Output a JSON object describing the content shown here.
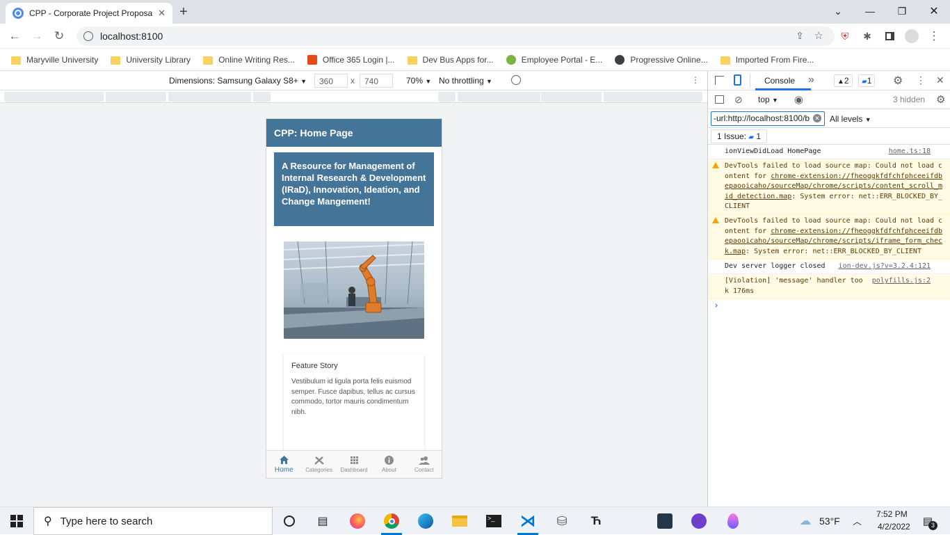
{
  "browser": {
    "tab_title": "CPP - Corporate Project Proposal",
    "url": "localhost:8100",
    "bookmarks": [
      {
        "label": "Maryville University",
        "icon": "folder-icon"
      },
      {
        "label": "University Library",
        "icon": "folder-icon"
      },
      {
        "label": "Online Writing Res...",
        "icon": "folder-icon"
      },
      {
        "label": "Office 365 Login |...",
        "icon": "office-icon"
      },
      {
        "label": "Dev Bus Apps for...",
        "icon": "folder-icon"
      },
      {
        "label": "Employee Portal - E...",
        "icon": "portal-icon"
      },
      {
        "label": "Progressive Online...",
        "icon": "globe-icon"
      },
      {
        "label": "Imported From Fire...",
        "icon": "folder-icon"
      }
    ]
  },
  "device_toolbar": {
    "dimensions_label": "Dimensions: Samsung Galaxy S8+",
    "width": "360",
    "height": "740",
    "times": "x",
    "zoom": "70%",
    "throttling": "No throttling"
  },
  "app": {
    "toolbar_title": "CPP: Home Page",
    "banner_text": "A Resource for Management of Internal Research & Development (IRaD), Innovation, Ideation, and Change Mangement!",
    "card_title": "Feature Story",
    "card_body": "Vestibulum id ligula porta felis euismod semper. Fusce dapibus, tellus ac cursus commodo, tortor mauris condimentum nibh.",
    "tabs": [
      {
        "label": "Home",
        "icon": "home-icon",
        "active": true
      },
      {
        "label": "Categories",
        "icon": "tools-icon",
        "active": false
      },
      {
        "label": "Dashboard",
        "icon": "grid-icon",
        "active": false
      },
      {
        "label": "About",
        "icon": "info-icon",
        "active": false
      },
      {
        "label": "Contact",
        "icon": "people-icon",
        "active": false
      }
    ],
    "accent_color": "#457499"
  },
  "devtools": {
    "panel_tab": "Console",
    "more_tabs": "»",
    "warnings_count": "2",
    "messages_count": "1",
    "context": "top",
    "hidden_count": "3 hidden",
    "filter_value": "-url:http://localhost:8100/b",
    "levels": "All levels",
    "issues_label": "1 Issue:",
    "issues_count": "1",
    "messages": [
      {
        "type": "log",
        "text": "ionViewDidLoad HomePage",
        "source": "home.ts:18"
      },
      {
        "type": "warn",
        "pre": "DevTools failed to load source map: Could not load content for ",
        "link": "chrome-extension://fheoggkfdfchfphceeifdbepaooicaho/sourceMap/chrome/scripts/content_scroll_mid_detection.map",
        "post": ": System error: net::ERR_BLOCKED_BY_CLIENT"
      },
      {
        "type": "warn",
        "pre": "DevTools failed to load source map: Could not load content for ",
        "link": "chrome-extension://fheoggkfdfchfphceeifdbepaooicaho/sourceMap/chrome/scripts/iframe_form_check.map",
        "post": ": System error: net::ERR_BLOCKED_BY_CLIENT"
      },
      {
        "type": "log",
        "text": "Dev server logger closed",
        "source": "ion-dev.js?v=3.2.4:121"
      },
      {
        "type": "violation",
        "text": "[Violation] 'message' handler took 176ms",
        "source": "polyfills.js:2"
      }
    ],
    "prompt": "›"
  },
  "taskbar": {
    "search_placeholder": "Type here to search",
    "weather": "53°F",
    "time": "7:52 PM",
    "date": "4/2/2022",
    "notification_count": "3"
  }
}
